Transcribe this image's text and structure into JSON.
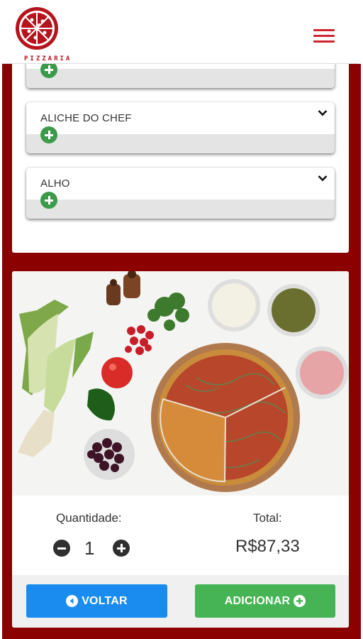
{
  "header": {
    "logo_text": "PIZZARIA",
    "menu_icon": "hamburger-menu-icon",
    "brand_color": "#d0232e"
  },
  "options": [
    {
      "label": ""
    },
    {
      "label": "ALICHE DO CHEF"
    },
    {
      "label": "ALHO"
    }
  ],
  "product": {
    "quantity_label": "Quantidade:",
    "quantity_value": "1",
    "total_label": "Total:",
    "total_value": "R$87,33"
  },
  "actions": {
    "back_label": "VOLTAR",
    "add_label": "ADICIONAR",
    "back_color": "#1a8cf0",
    "add_color": "#46b455"
  },
  "theme": {
    "frame_color": "#8b0000"
  }
}
